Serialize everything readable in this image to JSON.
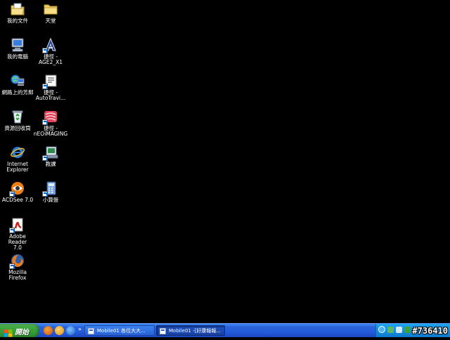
{
  "desktop": {
    "icons": [
      {
        "label": "我的文件",
        "icon": "my-documents-icon"
      },
      {
        "label": "我的電腦",
        "icon": "my-computer-icon"
      },
      {
        "label": "網路上的芳鄰",
        "icon": "network-places-icon"
      },
      {
        "label": "資源回收筒",
        "icon": "recycle-bin-icon"
      },
      {
        "label": "Internet\nExplorer",
        "icon": "internet-explorer-icon"
      },
      {
        "label": "ACDSee 7.0",
        "icon": "acdsee-icon"
      },
      {
        "label": "Adobe Reader\n7.0",
        "icon": "adobe-reader-icon"
      },
      {
        "label": "Mozilla Firefox",
        "icon": "firefox-icon"
      },
      {
        "label": "天堂",
        "icon": "folder-icon"
      },
      {
        "label": "捷徑 -\nAGE2_X1",
        "icon": "age-shortcut-icon"
      },
      {
        "label": "捷徑 -\nAutoTravi...",
        "icon": "autotravi-shortcut-icon"
      },
      {
        "label": "捷徑 -\nnEOiMAGING",
        "icon": "neoimaging-shortcut-icon"
      },
      {
        "label": "教課",
        "icon": "lesson-icon"
      },
      {
        "label": "小算盤",
        "icon": "calculator-icon"
      }
    ]
  },
  "taskbar": {
    "start_label": "開始",
    "quick_launch": [
      "firefox-icon",
      "media-icon",
      "internet-explorer-icon"
    ],
    "buttons": [
      {
        "label": "Mobile01 各位大大..."
      },
      {
        "label": "Mobile01 -[好康報報..."
      }
    ]
  },
  "watermark": "#736410",
  "colors": {
    "taskbar": "#245cdb",
    "start_button": "#39a13b",
    "tray": "#1590e1",
    "desktop": "#000000"
  }
}
